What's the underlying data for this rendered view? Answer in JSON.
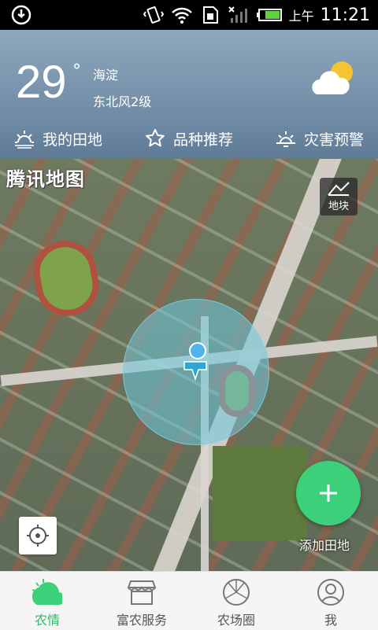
{
  "status_bar": {
    "ampm": "上午",
    "time": "11:21",
    "icons": [
      "sync-icon",
      "vibrate-icon",
      "wifi-icon",
      "sim-icon",
      "signal-icon",
      "battery-icon"
    ]
  },
  "weather": {
    "temperature": "29",
    "degree": "°",
    "city": "海淀",
    "wind": "东北风2级",
    "icon": "partly-sunny-icon"
  },
  "quick_nav": [
    {
      "label": "我的田地",
      "icon": "sun-field-icon"
    },
    {
      "label": "品种推荐",
      "icon": "star-icon"
    },
    {
      "label": "灾害预警",
      "icon": "warning-sun-icon"
    }
  ],
  "map": {
    "brand": "腾讯地图",
    "plot_button_label": "地块",
    "add_label": "添加田地"
  },
  "tabs": [
    {
      "label": "农情",
      "icon": "weather-leaf-icon",
      "active": true
    },
    {
      "label": "富农服务",
      "icon": "store-icon",
      "active": false
    },
    {
      "label": "农场圈",
      "icon": "aperture-icon",
      "active": false
    },
    {
      "label": "我",
      "icon": "person-icon",
      "active": false
    }
  ],
  "colors": {
    "accent": "#3dd07a",
    "active_tab": "#37b568",
    "weather_bg": "#7b95ad"
  }
}
